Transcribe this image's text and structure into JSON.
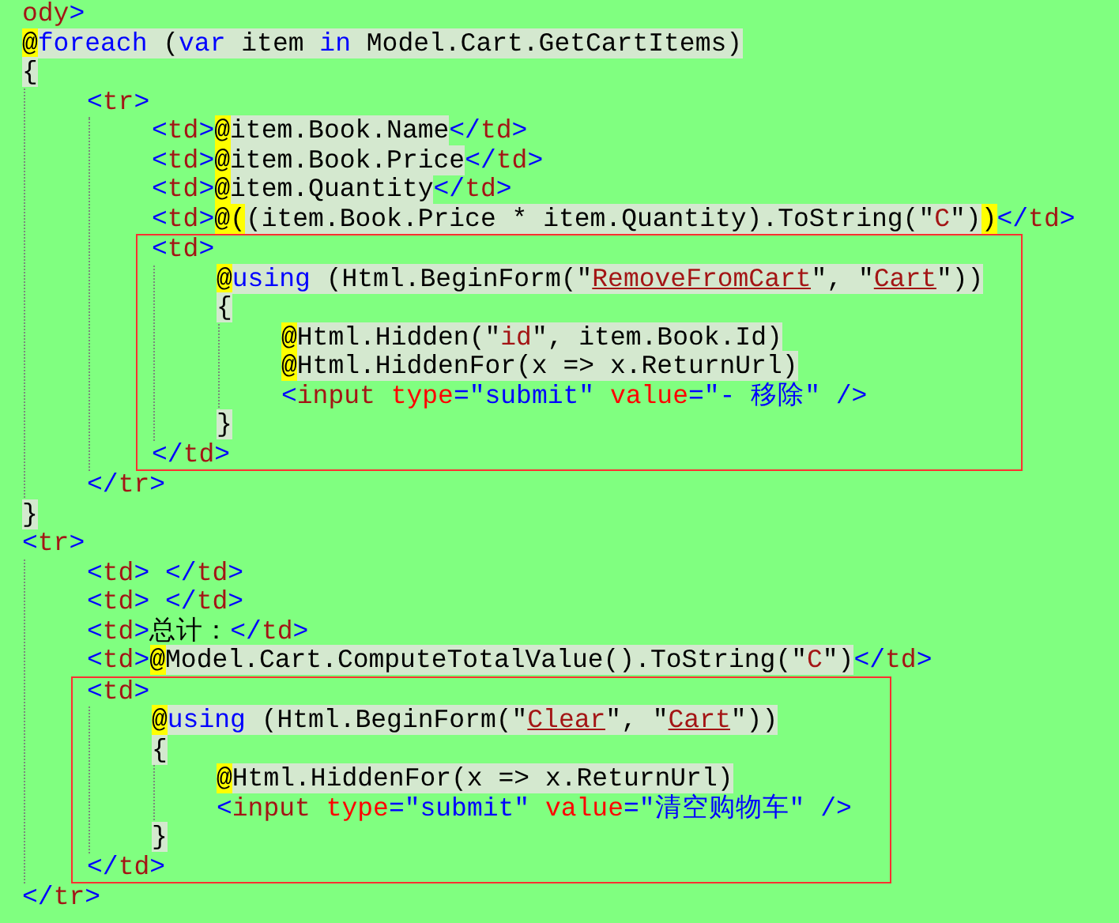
{
  "editor": {
    "lines": [
      {
        "kind": "line",
        "tokens": [
          {
            "kind": "tag-name",
            "text": "ody"
          },
          {
            "kind": "tag-bracket",
            "text": ">"
          }
        ]
      },
      {
        "kind": "line",
        "tokens": [
          {
            "kind": "at",
            "text": "@"
          },
          {
            "kind": "razor-keyword",
            "text": "foreach"
          },
          {
            "kind": "razor",
            "text": " ("
          },
          {
            "kind": "razor-keyword",
            "text": "var"
          },
          {
            "kind": "razor",
            "text": " item "
          },
          {
            "kind": "razor-keyword",
            "text": "in"
          },
          {
            "kind": "razor",
            "text": " Model.Cart.GetCartItems)"
          }
        ]
      },
      {
        "kind": "line",
        "tokens": [
          {
            "kind": "razor",
            "text": "{"
          }
        ],
        "children": [
          {
            "kind": "line",
            "tokens": [
              {
                "kind": "tag-bracket",
                "text": "<"
              },
              {
                "kind": "tag-name",
                "text": "tr"
              },
              {
                "kind": "tag-bracket",
                "text": ">"
              }
            ],
            "children": [
              {
                "kind": "line",
                "tokens": [
                  {
                    "kind": "tag-bracket",
                    "text": "<"
                  },
                  {
                    "kind": "tag-name",
                    "text": "td"
                  },
                  {
                    "kind": "tag-bracket",
                    "text": ">"
                  },
                  {
                    "kind": "at",
                    "text": "@"
                  },
                  {
                    "kind": "razor",
                    "text": "item.Book.Name"
                  },
                  {
                    "kind": "tag-bracket",
                    "text": "</"
                  },
                  {
                    "kind": "tag-name",
                    "text": "td"
                  },
                  {
                    "kind": "tag-bracket",
                    "text": ">"
                  }
                ]
              },
              {
                "kind": "line",
                "tokens": [
                  {
                    "kind": "tag-bracket",
                    "text": "<"
                  },
                  {
                    "kind": "tag-name",
                    "text": "td"
                  },
                  {
                    "kind": "tag-bracket",
                    "text": ">"
                  },
                  {
                    "kind": "at",
                    "text": "@"
                  },
                  {
                    "kind": "razor",
                    "text": "item.Book.Price"
                  },
                  {
                    "kind": "tag-bracket",
                    "text": "</"
                  },
                  {
                    "kind": "tag-name",
                    "text": "td"
                  },
                  {
                    "kind": "tag-bracket",
                    "text": ">"
                  }
                ]
              },
              {
                "kind": "line",
                "tokens": [
                  {
                    "kind": "tag-bracket",
                    "text": "<"
                  },
                  {
                    "kind": "tag-name",
                    "text": "td"
                  },
                  {
                    "kind": "tag-bracket",
                    "text": ">"
                  },
                  {
                    "kind": "at",
                    "text": "@"
                  },
                  {
                    "kind": "razor",
                    "text": "item.Quantity"
                  },
                  {
                    "kind": "tag-bracket",
                    "text": "</"
                  },
                  {
                    "kind": "tag-name",
                    "text": "td"
                  },
                  {
                    "kind": "tag-bracket",
                    "text": ">"
                  }
                ]
              },
              {
                "kind": "line",
                "tokens": [
                  {
                    "kind": "tag-bracket",
                    "text": "<"
                  },
                  {
                    "kind": "tag-name",
                    "text": "td"
                  },
                  {
                    "kind": "tag-bracket",
                    "text": ">"
                  },
                  {
                    "kind": "at",
                    "text": "@("
                  },
                  {
                    "kind": "razor",
                    "text": "(item.Book.Price * item.Quantity).ToString(\""
                  },
                  {
                    "kind": "razor-string",
                    "text": "C"
                  },
                  {
                    "kind": "razor",
                    "text": "\")"
                  },
                  {
                    "kind": "at",
                    "text": ")"
                  },
                  {
                    "kind": "tag-bracket",
                    "text": "</"
                  },
                  {
                    "kind": "tag-name",
                    "text": "td"
                  },
                  {
                    "kind": "tag-bracket",
                    "text": ">"
                  }
                ]
              },
              {
                "kind": "box",
                "lines": [
                  {
                    "kind": "line",
                    "tokens": [
                      {
                        "kind": "tag-bracket",
                        "text": "<"
                      },
                      {
                        "kind": "tag-name",
                        "text": "td"
                      },
                      {
                        "kind": "tag-bracket",
                        "text": ">"
                      }
                    ],
                    "children": [
                      {
                        "kind": "line",
                        "tokens": [
                          {
                            "kind": "at",
                            "text": "@"
                          },
                          {
                            "kind": "razor-keyword",
                            "text": "using"
                          },
                          {
                            "kind": "razor",
                            "text": " (Html.BeginForm(\""
                          },
                          {
                            "kind": "razor-link",
                            "text": "RemoveFromCart"
                          },
                          {
                            "kind": "razor",
                            "text": "\", \""
                          },
                          {
                            "kind": "razor-link",
                            "text": "Cart"
                          },
                          {
                            "kind": "razor",
                            "text": "\"))"
                          }
                        ]
                      },
                      {
                        "kind": "line",
                        "tokens": [
                          {
                            "kind": "razor",
                            "text": "{"
                          }
                        ],
                        "children": [
                          {
                            "kind": "line",
                            "tokens": [
                              {
                                "kind": "at",
                                "text": "@"
                              },
                              {
                                "kind": "razor",
                                "text": "Html.Hidden(\""
                              },
                              {
                                "kind": "razor-string",
                                "text": "id"
                              },
                              {
                                "kind": "razor",
                                "text": "\", item.Book.Id)"
                              }
                            ]
                          },
                          {
                            "kind": "line",
                            "tokens": [
                              {
                                "kind": "at",
                                "text": "@"
                              },
                              {
                                "kind": "razor",
                                "text": "Html.HiddenFor(x => x.ReturnUrl)"
                              }
                            ]
                          },
                          {
                            "kind": "line",
                            "tokens": [
                              {
                                "kind": "tag-bracket",
                                "text": "<"
                              },
                              {
                                "kind": "tag-name",
                                "text": "input"
                              },
                              {
                                "kind": "attr",
                                "text": " type"
                              },
                              {
                                "kind": "tag-bracket",
                                "text": "="
                              },
                              {
                                "kind": "attr-value",
                                "text": "\"submit\""
                              },
                              {
                                "kind": "attr",
                                "text": " value"
                              },
                              {
                                "kind": "tag-bracket",
                                "text": "="
                              },
                              {
                                "kind": "attr-value",
                                "text": "\"- 移除\""
                              },
                              {
                                "kind": "tag-bracket",
                                "text": " />"
                              }
                            ]
                          }
                        ]
                      },
                      {
                        "kind": "line",
                        "tokens": [
                          {
                            "kind": "razor",
                            "text": "}"
                          }
                        ]
                      }
                    ]
                  },
                  {
                    "kind": "line",
                    "tokens": [
                      {
                        "kind": "tag-bracket",
                        "text": "</"
                      },
                      {
                        "kind": "tag-name",
                        "text": "td"
                      },
                      {
                        "kind": "tag-bracket",
                        "text": ">"
                      }
                    ]
                  }
                ]
              }
            ]
          },
          {
            "kind": "line",
            "tokens": [
              {
                "kind": "tag-bracket",
                "text": "</"
              },
              {
                "kind": "tag-name",
                "text": "tr"
              },
              {
                "kind": "tag-bracket",
                "text": ">"
              }
            ]
          }
        ]
      },
      {
        "kind": "line",
        "tokens": [
          {
            "kind": "razor",
            "text": "}"
          }
        ]
      },
      {
        "kind": "line",
        "tokens": [
          {
            "kind": "tag-bracket",
            "text": "<"
          },
          {
            "kind": "tag-name",
            "text": "tr"
          },
          {
            "kind": "tag-bracket",
            "text": ">"
          }
        ],
        "children": [
          {
            "kind": "line",
            "tokens": [
              {
                "kind": "tag-bracket",
                "text": "<"
              },
              {
                "kind": "tag-name",
                "text": "td"
              },
              {
                "kind": "tag-bracket",
                "text": "> </"
              },
              {
                "kind": "tag-name",
                "text": "td"
              },
              {
                "kind": "tag-bracket",
                "text": ">"
              }
            ]
          },
          {
            "kind": "line",
            "tokens": [
              {
                "kind": "tag-bracket",
                "text": "<"
              },
              {
                "kind": "tag-name",
                "text": "td"
              },
              {
                "kind": "tag-bracket",
                "text": "> </"
              },
              {
                "kind": "tag-name",
                "text": "td"
              },
              {
                "kind": "tag-bracket",
                "text": ">"
              }
            ]
          },
          {
            "kind": "line",
            "tokens": [
              {
                "kind": "tag-bracket",
                "text": "<"
              },
              {
                "kind": "tag-name",
                "text": "td"
              },
              {
                "kind": "tag-bracket",
                "text": ">"
              },
              {
                "kind": "text",
                "text": "总计："
              },
              {
                "kind": "tag-bracket",
                "text": "</"
              },
              {
                "kind": "tag-name",
                "text": "td"
              },
              {
                "kind": "tag-bracket",
                "text": ">"
              }
            ]
          },
          {
            "kind": "line",
            "tokens": [
              {
                "kind": "tag-bracket",
                "text": "<"
              },
              {
                "kind": "tag-name",
                "text": "td"
              },
              {
                "kind": "tag-bracket",
                "text": ">"
              },
              {
                "kind": "at",
                "text": "@"
              },
              {
                "kind": "razor",
                "text": "Model.Cart.ComputeTotalValue().ToString(\""
              },
              {
                "kind": "razor-string",
                "text": "C"
              },
              {
                "kind": "razor",
                "text": "\")"
              },
              {
                "kind": "tag-bracket",
                "text": "</"
              },
              {
                "kind": "tag-name",
                "text": "td"
              },
              {
                "kind": "tag-bracket",
                "text": ">"
              }
            ]
          },
          {
            "kind": "box",
            "lines": [
              {
                "kind": "line",
                "tokens": [
                  {
                    "kind": "tag-bracket",
                    "text": "<"
                  },
                  {
                    "kind": "tag-name",
                    "text": "td"
                  },
                  {
                    "kind": "tag-bracket",
                    "text": ">"
                  }
                ],
                "children": [
                  {
                    "kind": "line",
                    "tokens": [
                      {
                        "kind": "at",
                        "text": "@"
                      },
                      {
                        "kind": "razor-keyword",
                        "text": "using"
                      },
                      {
                        "kind": "razor",
                        "text": " (Html.BeginForm(\""
                      },
                      {
                        "kind": "razor-link",
                        "text": "Clear"
                      },
                      {
                        "kind": "razor",
                        "text": "\", \""
                      },
                      {
                        "kind": "razor-link",
                        "text": "Cart"
                      },
                      {
                        "kind": "razor",
                        "text": "\"))"
                      }
                    ]
                  },
                  {
                    "kind": "line",
                    "tokens": [
                      {
                        "kind": "razor",
                        "text": "{"
                      }
                    ],
                    "children": [
                      {
                        "kind": "line",
                        "tokens": [
                          {
                            "kind": "at",
                            "text": "@"
                          },
                          {
                            "kind": "razor",
                            "text": "Html.HiddenFor(x => x.ReturnUrl)"
                          }
                        ]
                      },
                      {
                        "kind": "line",
                        "tokens": [
                          {
                            "kind": "tag-bracket",
                            "text": "<"
                          },
                          {
                            "kind": "tag-name",
                            "text": "input"
                          },
                          {
                            "kind": "attr",
                            "text": " type"
                          },
                          {
                            "kind": "tag-bracket",
                            "text": "="
                          },
                          {
                            "kind": "attr-value",
                            "text": "\"submit\""
                          },
                          {
                            "kind": "attr",
                            "text": " value"
                          },
                          {
                            "kind": "tag-bracket",
                            "text": "="
                          },
                          {
                            "kind": "attr-value",
                            "text": "\"清空购物车\""
                          },
                          {
                            "kind": "tag-bracket",
                            "text": " />"
                          }
                        ]
                      }
                    ]
                  },
                  {
                    "kind": "line",
                    "tokens": [
                      {
                        "kind": "razor",
                        "text": "}"
                      }
                    ]
                  }
                ]
              },
              {
                "kind": "line",
                "tokens": [
                  {
                    "kind": "tag-bracket",
                    "text": "</"
                  },
                  {
                    "kind": "tag-name",
                    "text": "td"
                  },
                  {
                    "kind": "tag-bracket",
                    "text": ">"
                  }
                ]
              }
            ]
          }
        ]
      },
      {
        "kind": "line",
        "tokens": [
          {
            "kind": "tag-bracket",
            "text": "</"
          },
          {
            "kind": "tag-name",
            "text": "tr"
          },
          {
            "kind": "tag-bracket",
            "text": ">"
          }
        ]
      }
    ]
  }
}
